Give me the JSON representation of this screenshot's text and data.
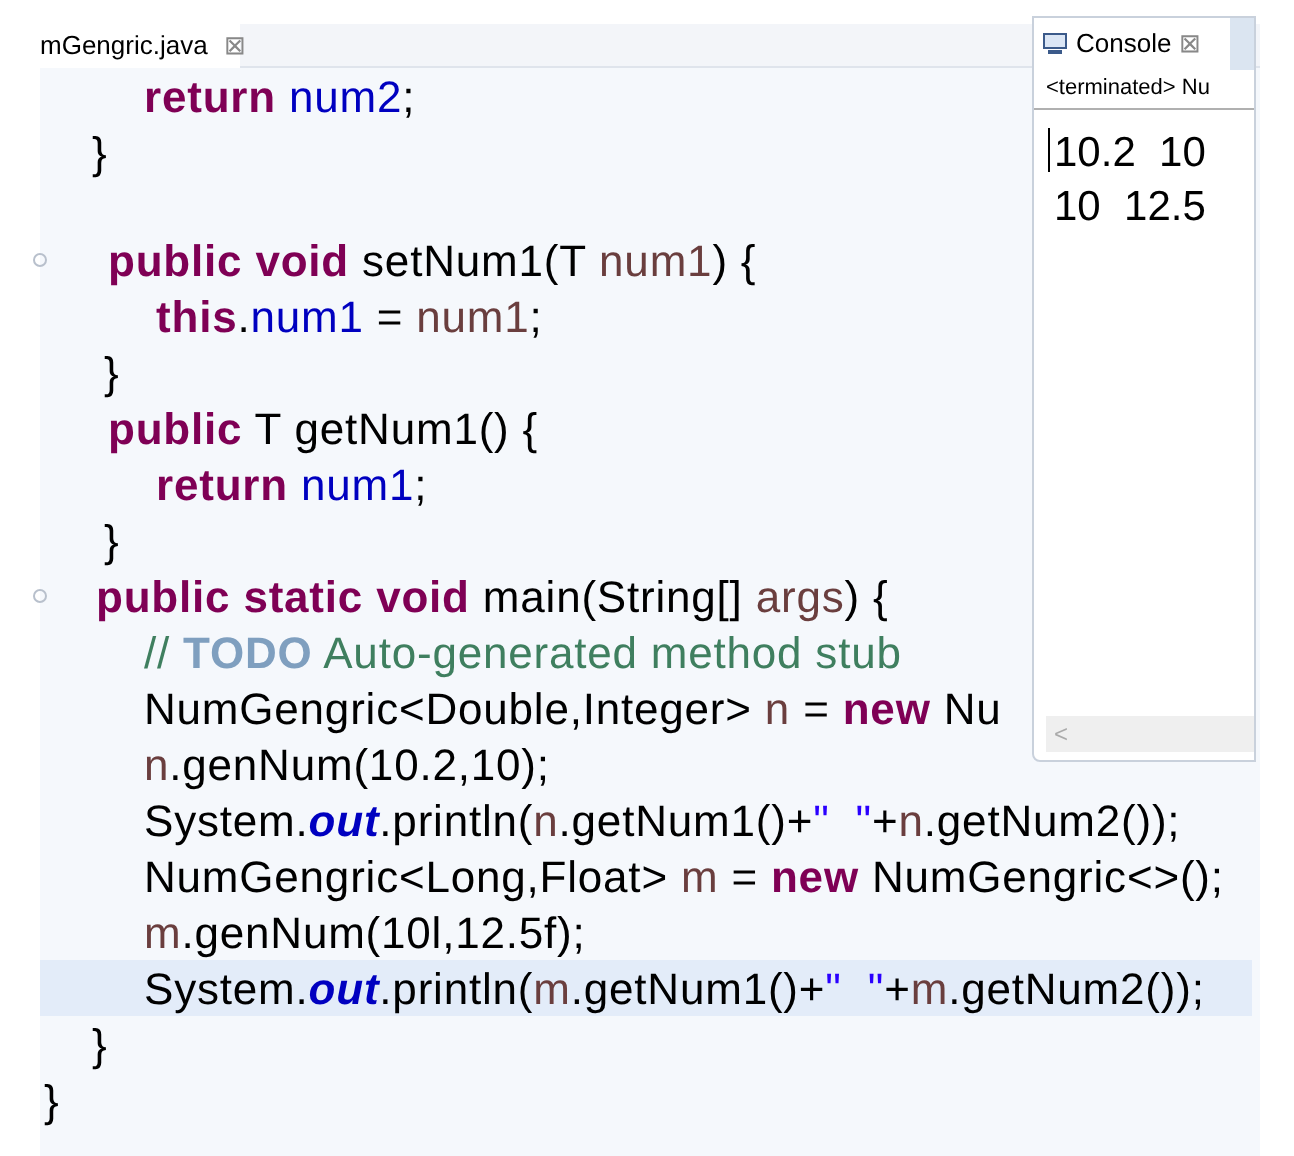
{
  "editor_tab": {
    "title": "mGengric.java",
    "close": "⊠"
  },
  "lines": [
    {
      "kind": "statement",
      "fold": false,
      "current": false,
      "tokens": [
        {
          "kind": "keyword",
          "text": "return"
        },
        {
          "kind": "field",
          "text": " num2"
        },
        {
          "kind": "plain",
          "text": ";"
        }
      ]
    },
    {
      "kind": "close",
      "fold": false,
      "current": false,
      "tokens": [
        {
          "kind": "plain",
          "text": "}"
        }
      ]
    },
    {
      "kind": "blank",
      "fold": false,
      "current": false
    },
    {
      "kind": "method",
      "fold": true,
      "current": false,
      "tokens": [
        {
          "kind": "keyword",
          "text": "public void"
        },
        {
          "kind": "plain",
          "text": " setNum1(T "
        },
        {
          "kind": "local",
          "text": "num1"
        },
        {
          "kind": "plain",
          "text": ") {"
        }
      ]
    },
    {
      "kind": "body",
      "fold": false,
      "current": false,
      "tokens": [
        {
          "kind": "keyword",
          "text": "this"
        },
        {
          "kind": "plain",
          "text": "."
        },
        {
          "kind": "field",
          "text": "num1"
        },
        {
          "kind": "plain",
          "text": " = "
        },
        {
          "kind": "local",
          "text": "num1"
        },
        {
          "kind": "plain",
          "text": ";"
        }
      ]
    },
    {
      "kind": "method_close",
      "fold": false,
      "current": false,
      "tokens": [
        {
          "kind": "plain",
          "text": "}"
        }
      ]
    },
    {
      "kind": "method",
      "fold": false,
      "current": false,
      "tokens": [
        {
          "kind": "keyword",
          "text": "public"
        },
        {
          "kind": "plain",
          "text": " T getNum1() {"
        }
      ]
    },
    {
      "kind": "body",
      "fold": false,
      "current": false,
      "tokens": [
        {
          "kind": "keyword",
          "text": "return"
        },
        {
          "kind": "field",
          "text": " num1"
        },
        {
          "kind": "plain",
          "text": ";"
        }
      ]
    },
    {
      "kind": "method_close",
      "fold": false,
      "current": false,
      "tokens": [
        {
          "kind": "plain",
          "text": "}"
        }
      ]
    },
    {
      "kind": "main",
      "fold": true,
      "current": false,
      "tokens": [
        {
          "kind": "keyword",
          "text": "public static void"
        },
        {
          "kind": "plain",
          "text": " main(String[] "
        },
        {
          "kind": "local",
          "text": "args"
        },
        {
          "kind": "plain",
          "text": ") {"
        }
      ]
    },
    {
      "kind": "statement",
      "fold": false,
      "current": false,
      "tokens": [
        {
          "kind": "comment",
          "text": "// "
        },
        {
          "kind": "todo",
          "text": "TODO"
        },
        {
          "kind": "comment",
          "text": " Auto-generated method stub"
        }
      ]
    },
    {
      "kind": "statement",
      "fold": false,
      "current": false,
      "tokens": [
        {
          "kind": "plain",
          "text": "NumGengric<Double,Integer> "
        },
        {
          "kind": "local",
          "text": "n"
        },
        {
          "kind": "plain",
          "text": " = "
        },
        {
          "kind": "keyword",
          "text": "new"
        },
        {
          "kind": "plain",
          "text": " Nu"
        }
      ]
    },
    {
      "kind": "statement",
      "fold": false,
      "current": false,
      "tokens": [
        {
          "kind": "local",
          "text": "n"
        },
        {
          "kind": "plain",
          "text": ".genNum(10.2,10);"
        }
      ]
    },
    {
      "kind": "statement",
      "fold": false,
      "current": false,
      "tokens": [
        {
          "kind": "plain",
          "text": "System."
        },
        {
          "kind": "static",
          "text": "out"
        },
        {
          "kind": "plain",
          "text": ".println("
        },
        {
          "kind": "local",
          "text": "n"
        },
        {
          "kind": "plain",
          "text": ".getNum1()+"
        },
        {
          "kind": "string",
          "text": "\"  \""
        },
        {
          "kind": "plain",
          "text": "+"
        },
        {
          "kind": "local",
          "text": "n"
        },
        {
          "kind": "plain",
          "text": ".getNum2());"
        }
      ]
    },
    {
      "kind": "statement",
      "fold": false,
      "current": false,
      "tokens": [
        {
          "kind": "plain",
          "text": "NumGengric<Long,Float> "
        },
        {
          "kind": "local",
          "text": "m"
        },
        {
          "kind": "plain",
          "text": " = "
        },
        {
          "kind": "keyword",
          "text": "new"
        },
        {
          "kind": "plain",
          "text": " NumGengric<>();"
        }
      ]
    },
    {
      "kind": "statement",
      "fold": false,
      "current": false,
      "tokens": [
        {
          "kind": "local",
          "text": "m"
        },
        {
          "kind": "plain",
          "text": ".genNum(10l,12.5f);"
        }
      ]
    },
    {
      "kind": "statement",
      "fold": false,
      "current": true,
      "tokens": [
        {
          "kind": "plain",
          "text": "System."
        },
        {
          "kind": "static",
          "text": "out"
        },
        {
          "kind": "plain",
          "text": ".println("
        },
        {
          "kind": "local",
          "text": "m"
        },
        {
          "kind": "plain",
          "text": ".getNum1()+"
        },
        {
          "kind": "string",
          "text": "\"  \""
        },
        {
          "kind": "plain",
          "text": "+"
        },
        {
          "kind": "local",
          "text": "m"
        },
        {
          "kind": "plain",
          "text": ".getNum2());"
        }
      ]
    },
    {
      "kind": "close",
      "fold": false,
      "current": false,
      "tokens": [
        {
          "kind": "plain",
          "text": "}"
        }
      ]
    },
    {
      "kind": "class_close",
      "fold": false,
      "current": false,
      "tokens": [
        {
          "kind": "plain",
          "text": "}"
        }
      ]
    }
  ],
  "console": {
    "title": "Console",
    "close": "⊠",
    "status": "<terminated> Nu",
    "output": [
      "10.2  10",
      "10  12.5"
    ],
    "scroll_left": "<"
  }
}
